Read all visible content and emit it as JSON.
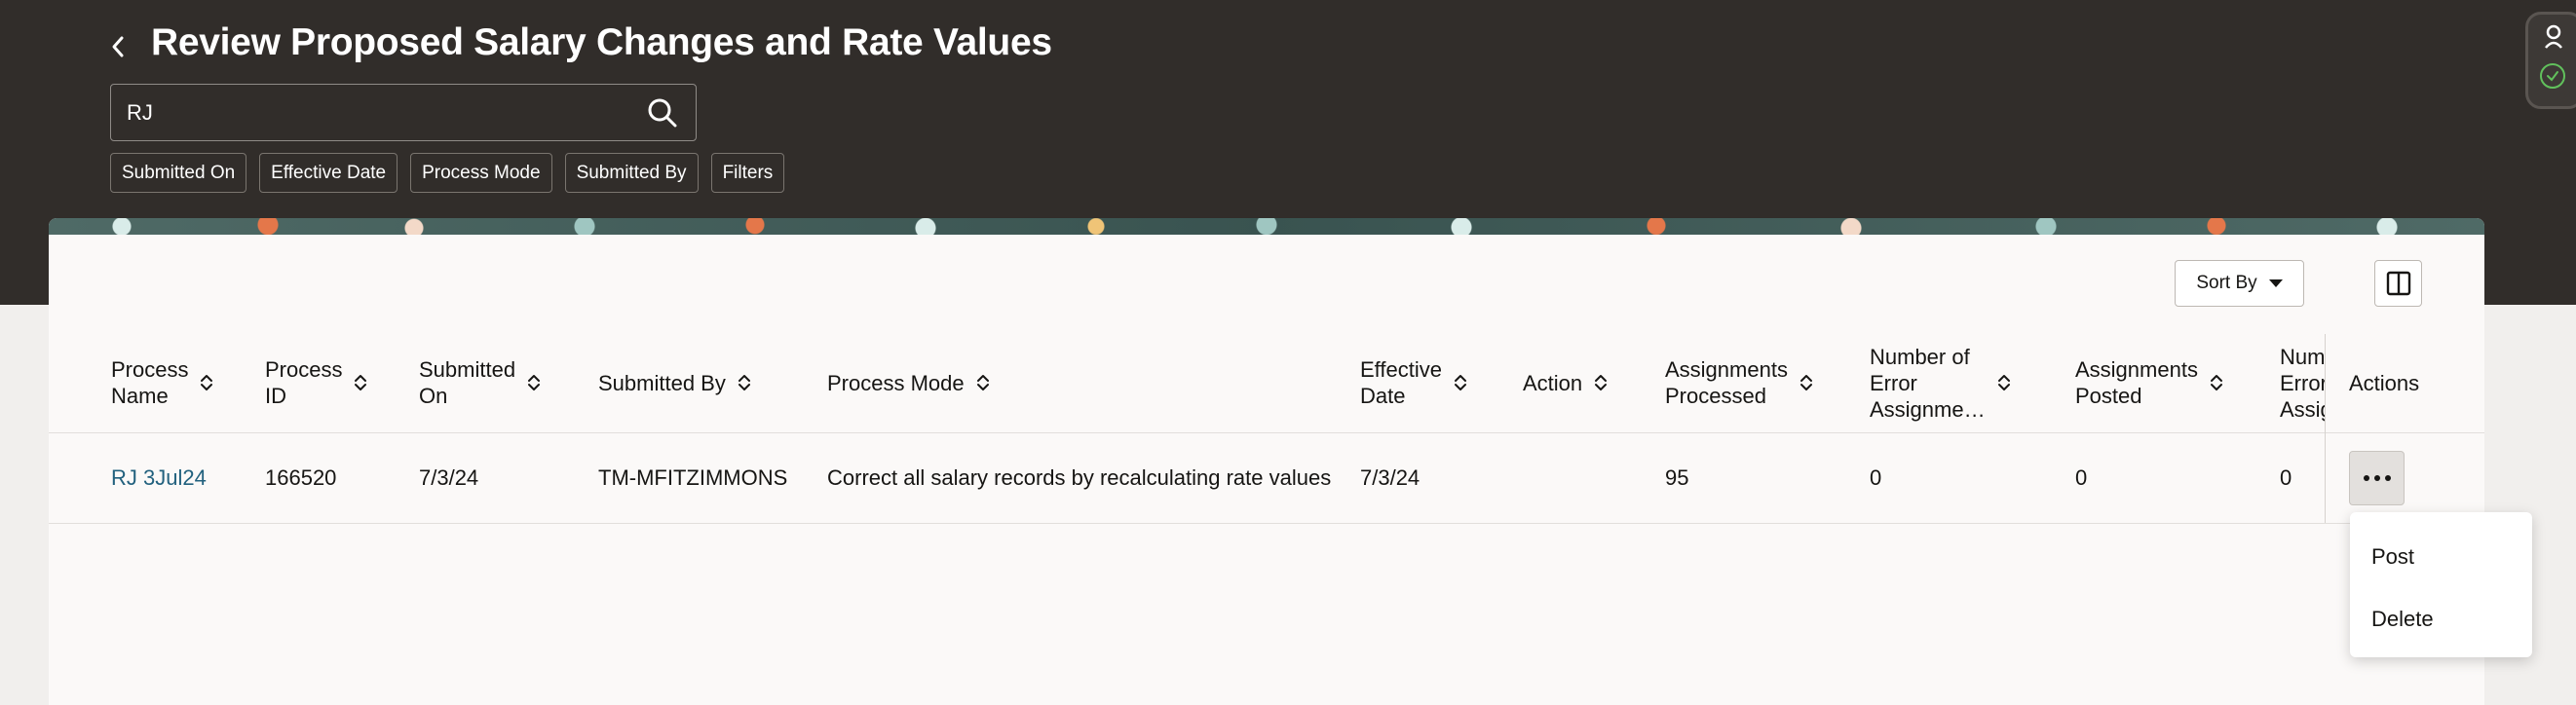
{
  "header": {
    "title": "Review Proposed Salary Changes and Rate Values"
  },
  "search": {
    "value": "RJ",
    "placeholder": ""
  },
  "filter_chips": [
    "Submitted On",
    "Effective Date",
    "Process Mode",
    "Submitted By",
    "Filters"
  ],
  "toolbar": {
    "sort_label": "Sort By"
  },
  "table": {
    "columns": [
      "Process Name",
      "Process ID",
      "Submitted On",
      "Submitted By",
      "Process Mode",
      "Effective Date",
      "Action",
      "Assignments Processed",
      "Number of Error Assignme…",
      "Assignments Posted",
      "Num Error Assig",
      "Actions"
    ],
    "column_lines": [
      [
        "Process",
        "Name"
      ],
      [
        "Process",
        "ID"
      ],
      [
        "Submitted",
        "On"
      ],
      [
        "Submitted By"
      ],
      [
        "Process Mode"
      ],
      [
        "Effective",
        "Date"
      ],
      [
        "Action"
      ],
      [
        "Assignments",
        "Processed"
      ],
      [
        "Number of",
        "Error",
        "Assignme…"
      ],
      [
        "Assignments",
        "Posted"
      ],
      [
        "Num",
        "Error",
        "Assig"
      ],
      [
        "Actions"
      ]
    ],
    "rows": [
      {
        "process_name": "RJ 3Jul24",
        "process_id": "166520",
        "submitted_on": "7/3/24",
        "submitted_by": "TM-MFITZIMMONS",
        "process_mode": "Correct all salary records by recalculating rate values",
        "effective_date": "7/3/24",
        "action": "",
        "assignments_processed": "95",
        "error_assignments": "0",
        "assignments_posted": "0",
        "num_error": "0"
      }
    ]
  },
  "row_menu": {
    "items": [
      "Post",
      "Delete"
    ]
  },
  "colors": {
    "header_bg": "#312d2a",
    "link": "#22617e",
    "page_bg": "#f1efed",
    "status_green": "#61c15c"
  }
}
